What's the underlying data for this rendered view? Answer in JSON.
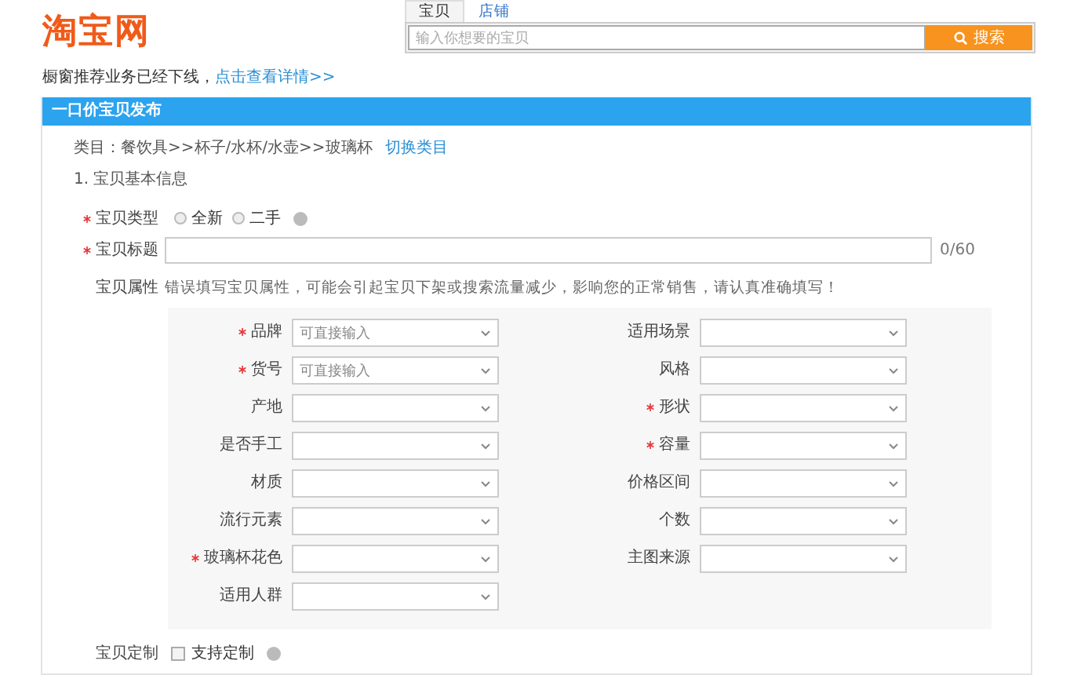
{
  "logo": "淘宝网",
  "search": {
    "tabs": [
      {
        "label": "宝贝",
        "selected": true
      },
      {
        "label": "店铺",
        "selected": false
      }
    ],
    "placeholder": "输入你想要的宝贝",
    "button": "搜索"
  },
  "notice": {
    "text": "橱窗推荐业务已经下线，",
    "link": "点击查看详情>>"
  },
  "panel": {
    "title": "一口价宝贝发布",
    "category": {
      "label": "类目：餐饮具>>杯子/水杯/水壶>>玻璃杯",
      "link": "切换类目"
    },
    "section": "1. 宝贝基本信息",
    "type": {
      "label": "宝贝类型",
      "required": true,
      "options": [
        {
          "label": "全新",
          "selected": false
        },
        {
          "label": "二手",
          "selected": false
        }
      ]
    },
    "title_field": {
      "label": "宝贝标题",
      "required": true,
      "counter": "0/60"
    },
    "attributes": {
      "label": "宝贝属性",
      "hint": "错误填写宝贝属性，可能会引起宝贝下架或搜索流量减少，影响您的正常销售，请认真准确填写！",
      "items": [
        {
          "label": "品牌",
          "required": true,
          "placeholder": "可直接输入"
        },
        {
          "label": "适用场景",
          "required": false
        },
        {
          "label": "货号",
          "required": true,
          "placeholder": "可直接输入"
        },
        {
          "label": "风格",
          "required": false
        },
        {
          "label": "产地",
          "required": false
        },
        {
          "label": "形状",
          "required": true
        },
        {
          "label": "是否手工",
          "required": false
        },
        {
          "label": "容量",
          "required": true
        },
        {
          "label": "材质",
          "required": false
        },
        {
          "label": "价格区间",
          "required": false
        },
        {
          "label": "流行元素",
          "required": false
        },
        {
          "label": "个数",
          "required": false
        },
        {
          "label": "玻璃杯花色",
          "required": true
        },
        {
          "label": "主图来源",
          "required": false
        },
        {
          "label": "适用人群",
          "required": false
        }
      ]
    },
    "custom": {
      "label": "宝贝定制",
      "option": "支持定制",
      "checked": false
    }
  }
}
